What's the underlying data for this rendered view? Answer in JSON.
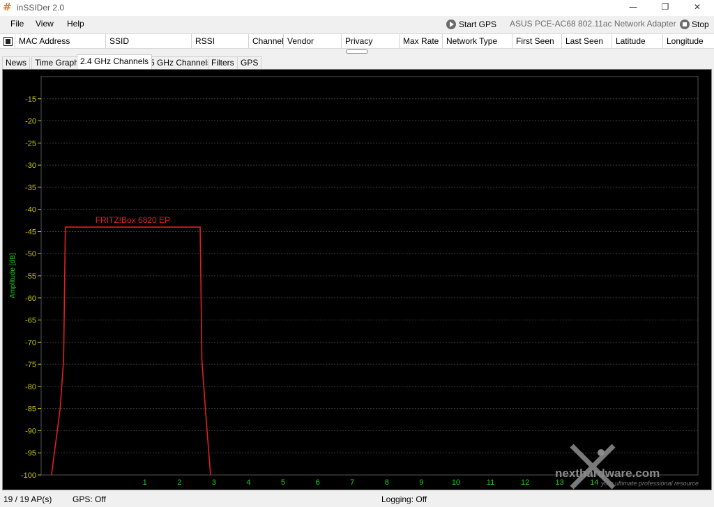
{
  "window": {
    "title": "inSSIDer 2.0",
    "app_icon": "#",
    "minimize_glyph": "—",
    "maximize_glyph": "❐",
    "close_glyph": "✕"
  },
  "menu": {
    "items": [
      "File",
      "View",
      "Help"
    ],
    "start_gps_label": "Start GPS",
    "adapter": "ASUS PCE-AC68 802.11ac Network Adapter",
    "stop_label": "Stop"
  },
  "columns": [
    "MAC Address",
    "SSID",
    "RSSI",
    "Channel",
    "Vendor",
    "Privacy",
    "Max Rate",
    "Network Type",
    "First Seen",
    "Last Seen",
    "Latitude",
    "Longitude"
  ],
  "tabs": {
    "items": [
      "News",
      "Time Graph",
      "2.4 GHz Channels",
      "5 GHz Channels",
      "Filters",
      "GPS"
    ],
    "active": "2.4 GHz Channels"
  },
  "status": {
    "ap_count": "19 / 19 AP(s)",
    "gps": "GPS: Off",
    "logging": "Logging: Off"
  },
  "watermark": {
    "brand": "nexthardware.com",
    "tagline": "your ultimate professional resource"
  },
  "colors": {
    "axis_text": "#c8c800",
    "ylabel": "#22cc22",
    "channel_labels": "#22cc22",
    "grid": "#3a3a3a",
    "network": "#e02020",
    "plot_border": "#555555"
  },
  "chart_data": {
    "type": "line",
    "title": "",
    "xlabel": "",
    "ylabel": "Amplitude [dB]",
    "ylim": [
      -100,
      -10
    ],
    "y_ticks": [
      -15,
      -20,
      -25,
      -30,
      -35,
      -40,
      -45,
      -50,
      -55,
      -60,
      -65,
      -70,
      -75,
      -80,
      -85,
      -90,
      -95,
      -100
    ],
    "xlim": [
      -2,
      17
    ],
    "x_ticks": [
      1,
      2,
      3,
      4,
      5,
      6,
      7,
      8,
      9,
      10,
      11,
      12,
      13,
      14
    ],
    "grid": true,
    "series": [
      {
        "name": "FRITZ!Box 6820 EP",
        "color": "#e02020",
        "points": [
          [
            -1.7,
            -100
          ],
          [
            -1.45,
            -85
          ],
          [
            -1.35,
            -74
          ],
          [
            -1.3,
            -44
          ],
          [
            2.6,
            -44
          ],
          [
            2.65,
            -74
          ],
          [
            2.75,
            -85
          ],
          [
            2.9,
            -100
          ]
        ]
      }
    ]
  }
}
